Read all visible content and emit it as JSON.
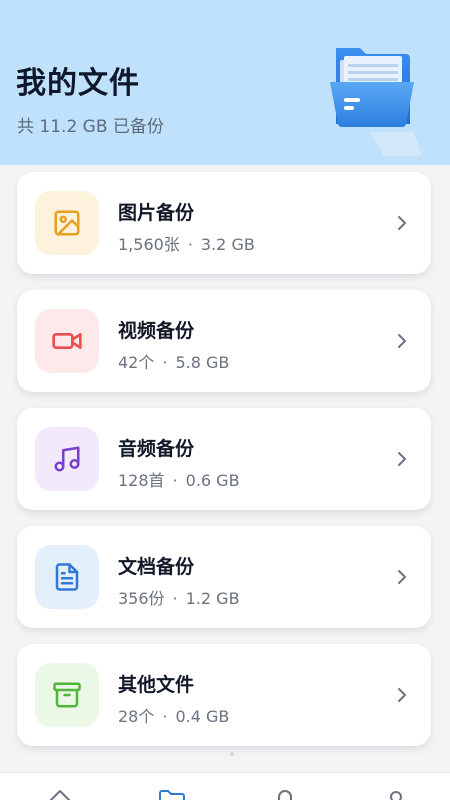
{
  "header": {
    "title": "我的文件",
    "subtitle": "共 11.2 GB 已备份"
  },
  "categories": [
    {
      "title": "图片备份",
      "count": "1,560张",
      "size": "3.2 GB",
      "icon": "image-icon",
      "color": "#e8a020",
      "bg": "#fdf3dd"
    },
    {
      "title": "视频备份",
      "count": "42个",
      "size": "5.8 GB",
      "icon": "video-camera-icon",
      "color": "#ec4f4f",
      "bg": "#fde9e9"
    },
    {
      "title": "音频备份",
      "count": "128首",
      "size": "0.6 GB",
      "icon": "music-note-icon",
      "color": "#7a3fc9",
      "bg": "#f3e9fd"
    },
    {
      "title": "文档备份",
      "count": "356份",
      "size": "1.2 GB",
      "icon": "document-icon",
      "color": "#2f7ad6",
      "bg": "#e4effc"
    },
    {
      "title": "其他文件",
      "count": "28个",
      "size": "0.4 GB",
      "icon": "archive-box-icon",
      "color": "#4fb836",
      "bg": "#ebf8e5"
    }
  ],
  "separator": "·",
  "bottom_nav": [
    {
      "icon": "home-icon"
    },
    {
      "icon": "folder-icon",
      "active": true
    },
    {
      "icon": "lock-icon"
    },
    {
      "icon": "profile-icon"
    }
  ],
  "colors": {
    "header_bg": "#bfe1fb",
    "nav_active": "#2f7ad6",
    "nav_inactive": "#6b7280"
  }
}
